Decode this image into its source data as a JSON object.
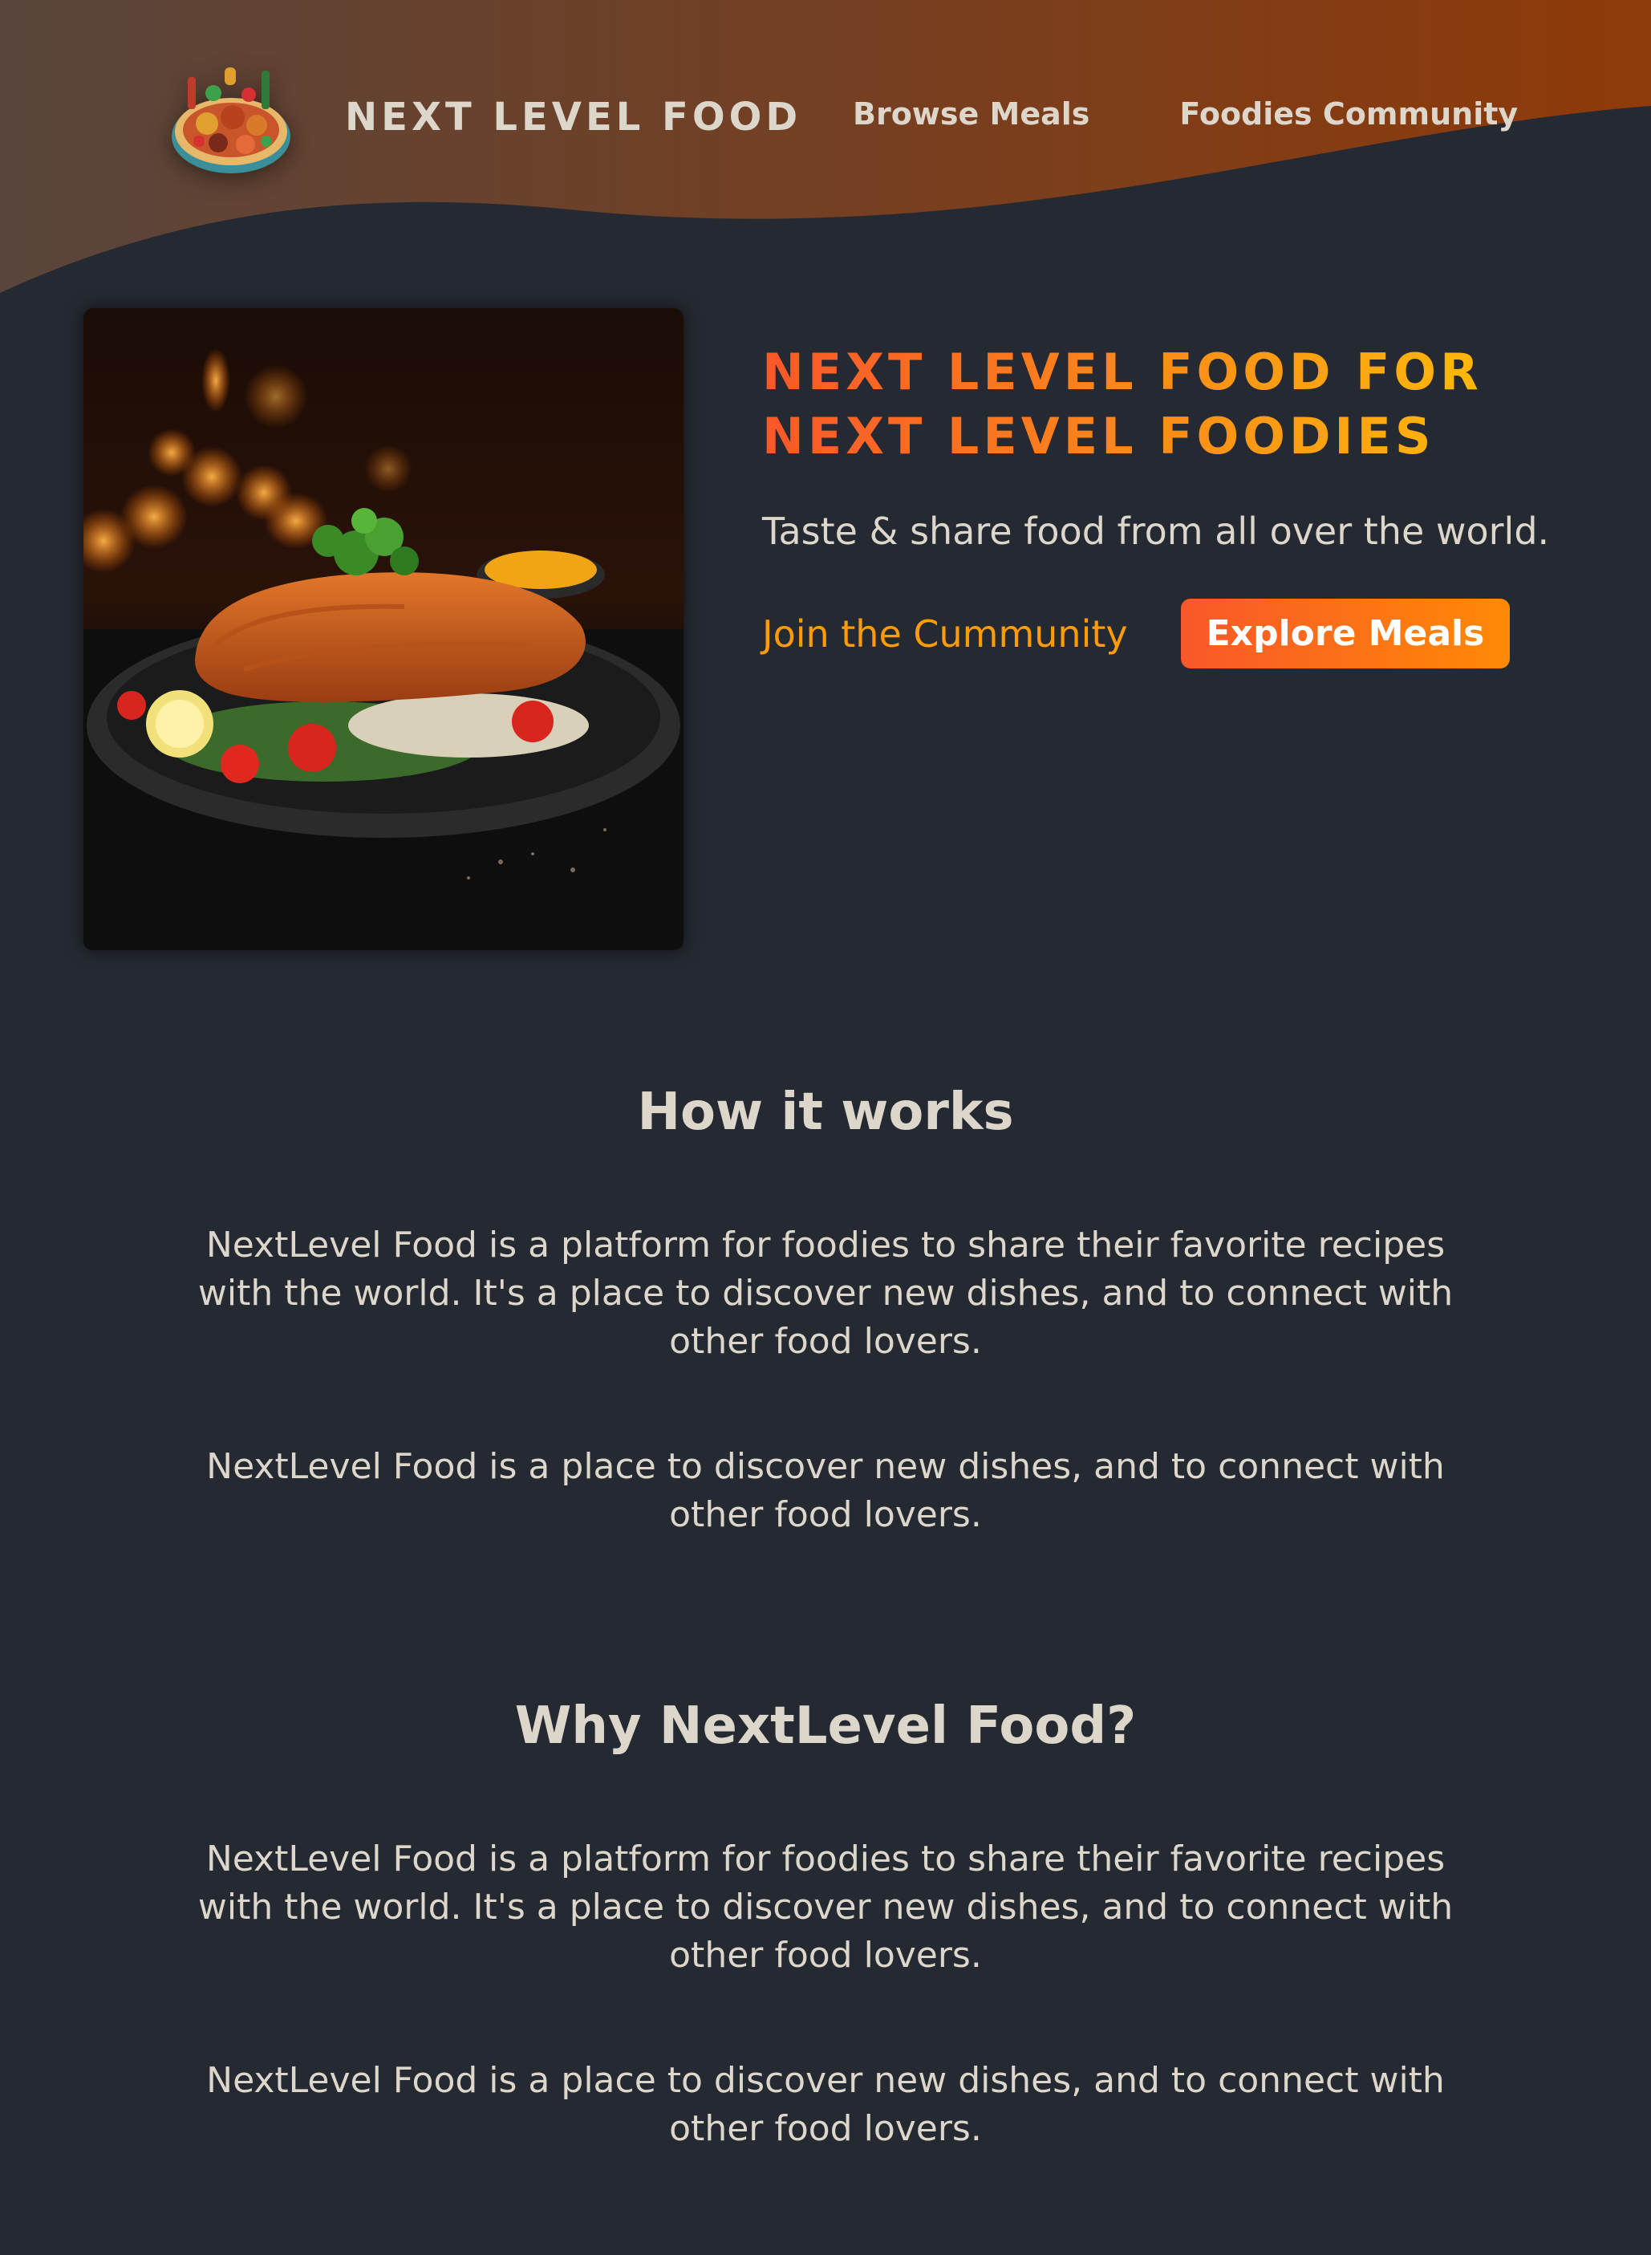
{
  "header": {
    "logo_alt": "A plate with food on it",
    "site_name": "NEXT LEVEL FOOD",
    "nav": [
      {
        "label": "Browse Meals"
      },
      {
        "label": "Foodies Community"
      }
    ]
  },
  "hero": {
    "image_alt": "A delicious schnitzel dish",
    "title_line1": "NEXT LEVEL FOOD FOR",
    "title_line2": "NEXT LEVEL FOODIES",
    "subtitle": "Taste & share food from all over the world.",
    "community_link": "Join the Cummunity",
    "explore_button": "Explore Meals"
  },
  "sections": [
    {
      "title": "How it works",
      "paragraphs": [
        "NextLevel Food is a platform for foodies to share their favorite recipes with the world. It's a place to discover new dishes, and to connect with other food lovers.",
        "NextLevel Food is a place to discover new dishes, and to connect with other food lovers."
      ]
    },
    {
      "title": "Why NextLevel Food?",
      "paragraphs": [
        "NextLevel Food is a platform for foodies to share their favorite recipes with the world. It's a place to discover new dishes, and to connect with other food lovers.",
        "NextLevel Food is a place to discover new dishes, and to connect with other food lovers."
      ]
    }
  ],
  "colors": {
    "background": "#252931",
    "text": "#ddd6cb",
    "accent_start": "#f9572a",
    "accent_end": "#ffc905",
    "link": "#ff9b05"
  }
}
